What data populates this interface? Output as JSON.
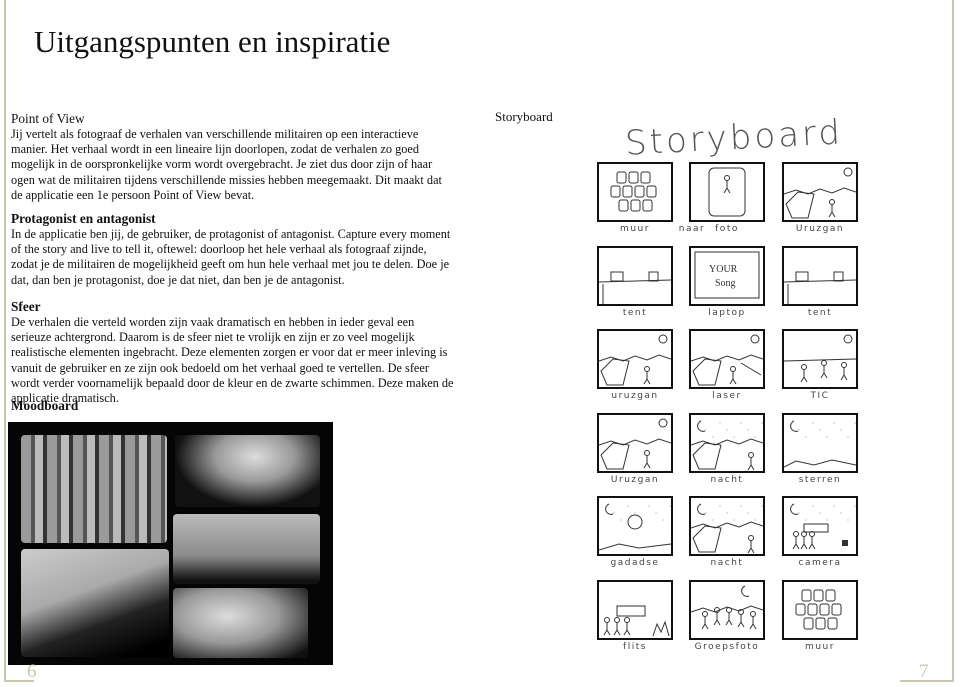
{
  "title": "Uitgangspunten en inspiratie",
  "sections": [
    {
      "heading": "Point of View",
      "body": "Jij vertelt als fotograaf de verhalen van verschillende militairen op een interactieve manier. Het verhaal wordt in een lineaire lijn doorlopen, zodat de verhalen zo goed mogelijk in de oorspronkelijke vorm wordt overgebracht. Je ziet dus door zijn of haar ogen wat de militairen tijdens verschillende missies hebben meegemaakt. Dit maakt dat de applicatie een 1e persoon Point of View bevat."
    },
    {
      "heading": "Protagonist en antagonist",
      "body": "In de applicatie ben jij, de gebruiker, de protagonist of antagonist. Capture every moment of the story and live to tell it, oftewel: doorloop het hele verhaal als fotograaf zijnde, zodat je de militairen de mogelijkheid geeft om hun hele verhaal met jou te delen. Doe je dat, dan ben je protagonist, doe je dat niet, dan ben je de antagonist."
    },
    {
      "heading": "Sfeer",
      "body": "De verhalen die verteld worden zijn vaak dramatisch en hebben in ieder geval een serieuze achtergrond. Daarom is de sfeer niet te vrolijk en zijn er zo veel mogelijk realistische elementen ingebracht. Deze elementen zorgen er voor dat er meer inleving is vanuit de gebruiker en ze zijn ook bedoeld om het verhaal goed te vertellen. De sfeer wordt verder voornamelijk bepaald door de kleur en de zwarte schimmen. Deze maken de applicatie dramatisch."
    }
  ],
  "moodboard_heading": "Moodboard",
  "storyboard": {
    "label": "Storyboard",
    "sketch_title": "Storyboard",
    "panels": [
      {
        "scene": "wall",
        "label": "muur",
        "extra": "naar"
      },
      {
        "scene": "photo",
        "label": "foto"
      },
      {
        "scene": "landscape-day",
        "label": "Uruzgan"
      },
      {
        "scene": "tent",
        "label": "tent"
      },
      {
        "scene": "laptop",
        "label": "laptop"
      },
      {
        "scene": "tent",
        "label": "tent"
      },
      {
        "scene": "landscape-day",
        "label": "uruzgan"
      },
      {
        "scene": "laser",
        "label": "laser"
      },
      {
        "scene": "tic",
        "label": "TIC"
      },
      {
        "scene": "landscape-day",
        "label": "Uruzgan"
      },
      {
        "scene": "landscape-night",
        "label": "nacht"
      },
      {
        "scene": "stars",
        "label": "sterren"
      },
      {
        "scene": "portrait-night",
        "label": "gadadse"
      },
      {
        "scene": "landscape-night",
        "label": "nacht"
      },
      {
        "scene": "camera",
        "label": "camera"
      },
      {
        "scene": "flash",
        "label": "flits"
      },
      {
        "scene": "group",
        "label": "Groepsfoto"
      },
      {
        "scene": "wall",
        "label": "muur"
      }
    ],
    "laptop_text": "YOUR Song"
  },
  "page_numbers": {
    "left": "6",
    "right": "7"
  },
  "colors": {
    "border": "#c9c8ad",
    "text": "#111111"
  }
}
